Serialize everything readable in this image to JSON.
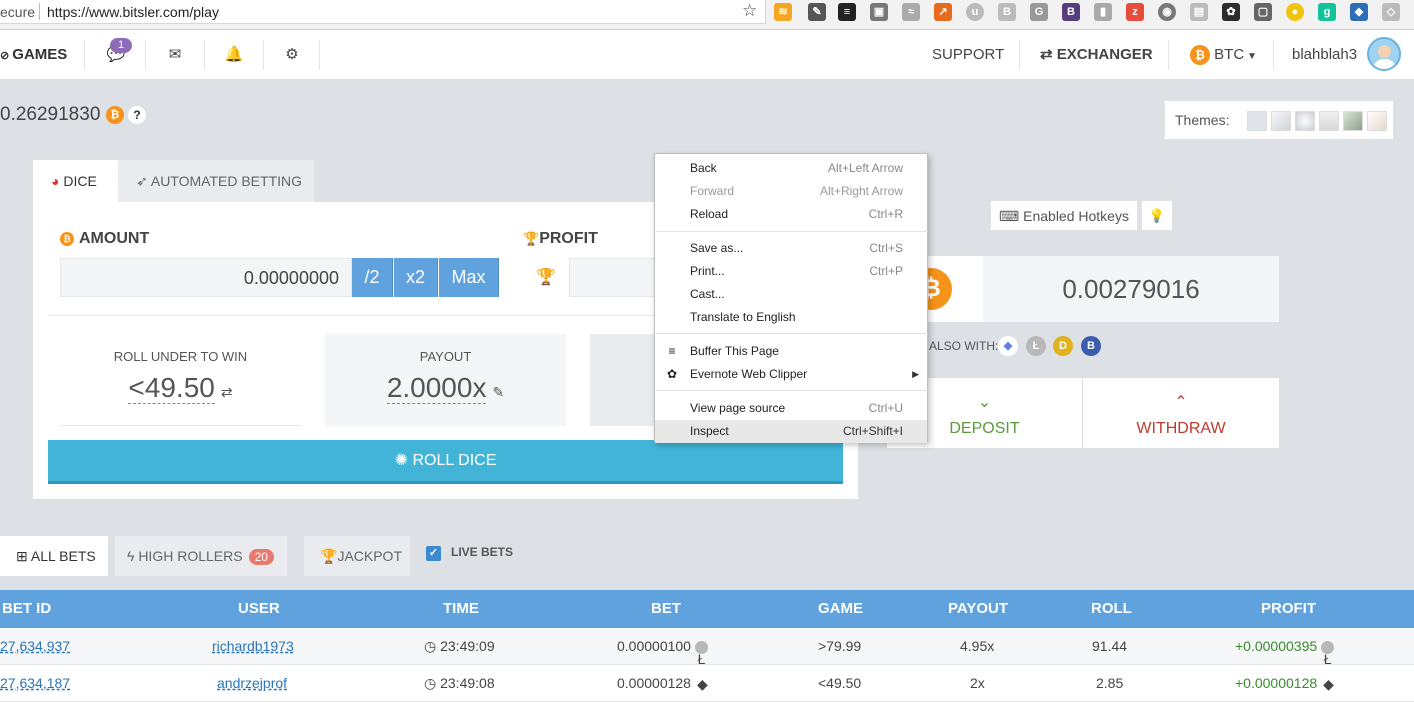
{
  "browser": {
    "secure_label": "ecure",
    "url": "https://www.bitsler.com/play"
  },
  "nav": {
    "games_label": "GAMES",
    "chat_badge": "1",
    "support_label": "SUPPORT",
    "exchanger_label": "EXCHANGER",
    "currency_label": "BTC",
    "username": "blahblah3"
  },
  "balance": {
    "value": "0.26291830",
    "help": "?"
  },
  "themes": {
    "label": "Themes:"
  },
  "game_tabs": {
    "dice": "DICE",
    "automated": "AUTOMATED BETTING"
  },
  "betform": {
    "amount_label": "AMOUNT",
    "amount_value": "0.00000000",
    "half_label": "/2",
    "double_label": "x2",
    "max_label": "Max",
    "profit_label": "PROFIT",
    "roll_under_label": "ROLL UNDER TO WIN",
    "roll_under_value": "<49.50",
    "payout_label": "PAYOUT",
    "payout_value": "2.0000x",
    "roll_button": "ROLL DICE"
  },
  "wallet": {
    "hotkeys_label": "Enabled Hotkeys",
    "btc_amount": "0.00279016",
    "also_with": "ALSO WITH:",
    "deposit_label": "DEPOSIT",
    "withdraw_label": "WITHDRAW"
  },
  "context_menu": {
    "items": [
      {
        "label": "Back",
        "shortcut": "Alt+Left Arrow"
      },
      {
        "label": "Forward",
        "shortcut": "Alt+Right Arrow"
      },
      {
        "label": "Reload",
        "shortcut": "Ctrl+R"
      },
      {
        "label": "Save as...",
        "shortcut": "Ctrl+S"
      },
      {
        "label": "Print...",
        "shortcut": "Ctrl+P"
      },
      {
        "label": "Cast...",
        "shortcut": ""
      },
      {
        "label": "Translate to English",
        "shortcut": ""
      },
      {
        "label": "Buffer This Page",
        "shortcut": ""
      },
      {
        "label": "Evernote Web Clipper",
        "shortcut": ""
      },
      {
        "label": "View page source",
        "shortcut": "Ctrl+U"
      },
      {
        "label": "Inspect",
        "shortcut": "Ctrl+Shift+I"
      }
    ]
  },
  "bets_tabs": {
    "all": "ALL BETS",
    "high": "HIGH ROLLERS",
    "high_count": "20",
    "jackpot": "JACKPOT",
    "live": "LIVE BETS"
  },
  "table": {
    "headers": [
      "BET ID",
      "USER",
      "TIME",
      "BET",
      "GAME",
      "PAYOUT",
      "ROLL",
      "PROFIT"
    ],
    "rows": [
      {
        "id": "27,634,937",
        "user": "richardb1973",
        "time": "23:49:09",
        "bet": "0.00000100",
        "game": ">79.99",
        "payout": "4.95x",
        "roll": "91.44",
        "profit": "+0.00000395"
      },
      {
        "id": "27,634,187",
        "user": "andrzejprof",
        "time": "23:49:08",
        "bet": "0.00000128",
        "game": "<49.50",
        "payout": "2x",
        "roll": "2.85",
        "profit": "+0.00000128"
      }
    ]
  },
  "colors": {
    "accent": "#5fa2dd",
    "roll_button": "#42b4d8",
    "btc": "#f7931a",
    "deposit": "#5a9a3a",
    "withdraw": "#c0392b"
  }
}
